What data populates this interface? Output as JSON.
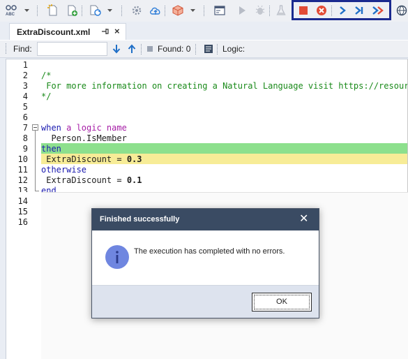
{
  "toolbar": {
    "highlighted_group": [
      "stop-button",
      "cancel-button",
      "step-button",
      "step-to-end-button",
      "run-to-end-button"
    ]
  },
  "tab": {
    "label": "ExtraDiscount.xml",
    "close_glyph": "×"
  },
  "findbar": {
    "find_label": "Find:",
    "find_value": "",
    "found_label": "Found: 0",
    "logic_label": "Logic:"
  },
  "editor": {
    "line_numbers": [
      "1",
      "2",
      "3",
      "4",
      "5",
      "6",
      "7",
      "8",
      "9",
      "10",
      "11",
      "12",
      "13",
      "14",
      "15",
      "16"
    ],
    "lines": {
      "l2": "/*",
      "l3": " For more information on creating a Natural Language visit https://resource",
      "l4": "*/",
      "l7_when": "when ",
      "l7_name": "a logic name",
      "l8": "  Person.IsMember",
      "l9": "then",
      "l10_prop": " ExtraDiscount = ",
      "l10_val": "0.3",
      "l11": "otherwise",
      "l12_prop": " ExtraDiscount = ",
      "l12_val": "0.1",
      "l13": "end"
    },
    "colors": {
      "comment": "#1a8a1a",
      "keyword": "#1b1bb0",
      "name": "#a61ea6",
      "current_line": "#8de08d",
      "pending_line": "#f7ec97"
    }
  },
  "dialog": {
    "title": "Finished successfully",
    "close_glyph": "✕",
    "message": "The execution has completed with no errors.",
    "ok_label": "OK",
    "icon": "info-icon"
  }
}
